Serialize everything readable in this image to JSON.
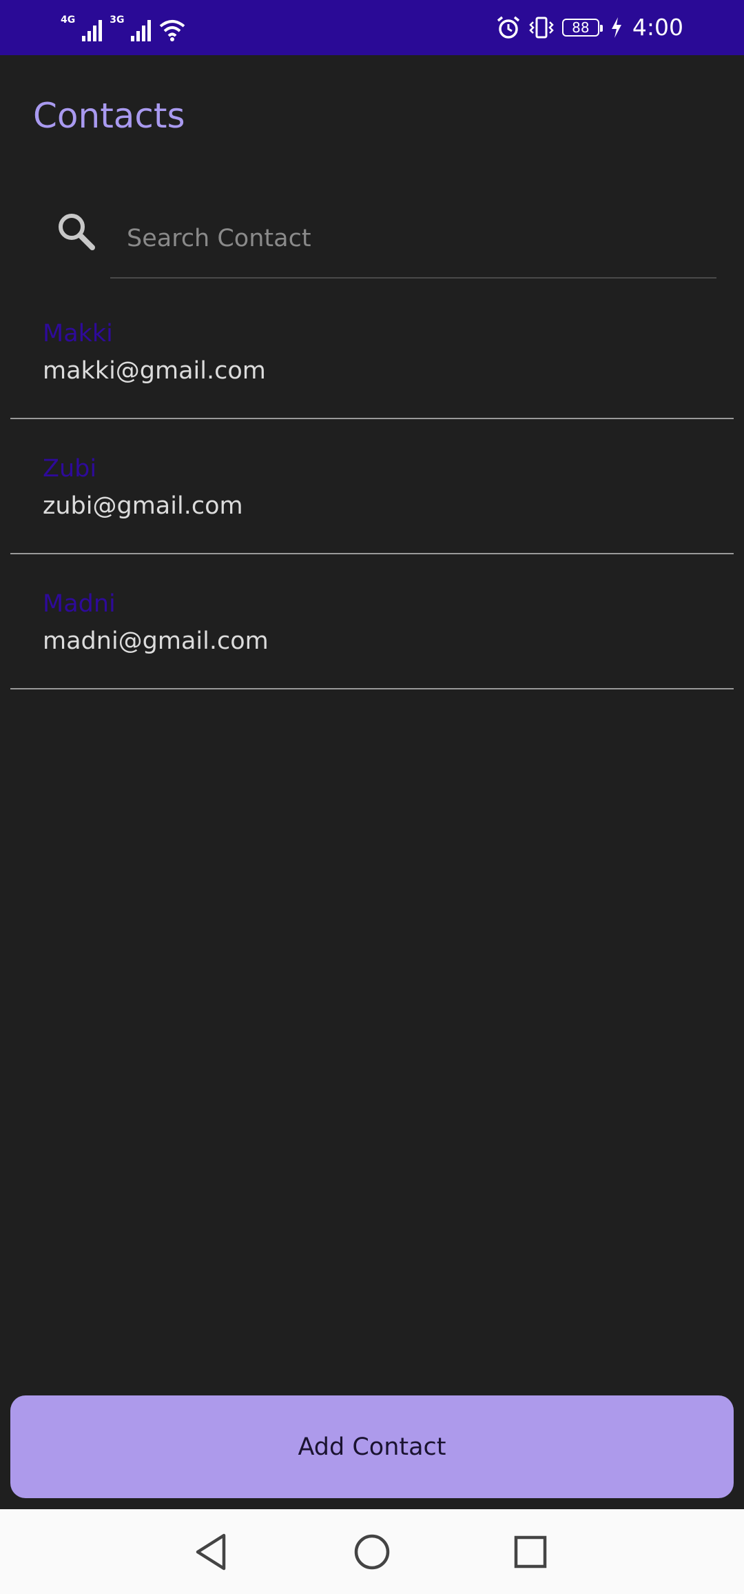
{
  "status_bar": {
    "network_1": "4G",
    "network_2": "3G",
    "battery_level": "88",
    "time": "4:00"
  },
  "header": {
    "title": "Contacts"
  },
  "search": {
    "placeholder": "Search Contact",
    "value": ""
  },
  "contacts": [
    {
      "name": "Makki",
      "email": "makki@gmail.com"
    },
    {
      "name": "Zubi",
      "email": "zubi@gmail.com"
    },
    {
      "name": "Madni",
      "email": "madni@gmail.com"
    }
  ],
  "actions": {
    "add_contact_label": "Add Contact"
  },
  "icons": {
    "search": "search-icon",
    "back": "back-triangle-icon",
    "home": "home-circle-icon",
    "recent": "recent-square-icon"
  },
  "colors": {
    "status_bar": "#2a0a96",
    "background": "#1f1f1f",
    "title": "#a99af0",
    "contact_name": "#2e0a9a",
    "button": "#ad9aeb"
  }
}
